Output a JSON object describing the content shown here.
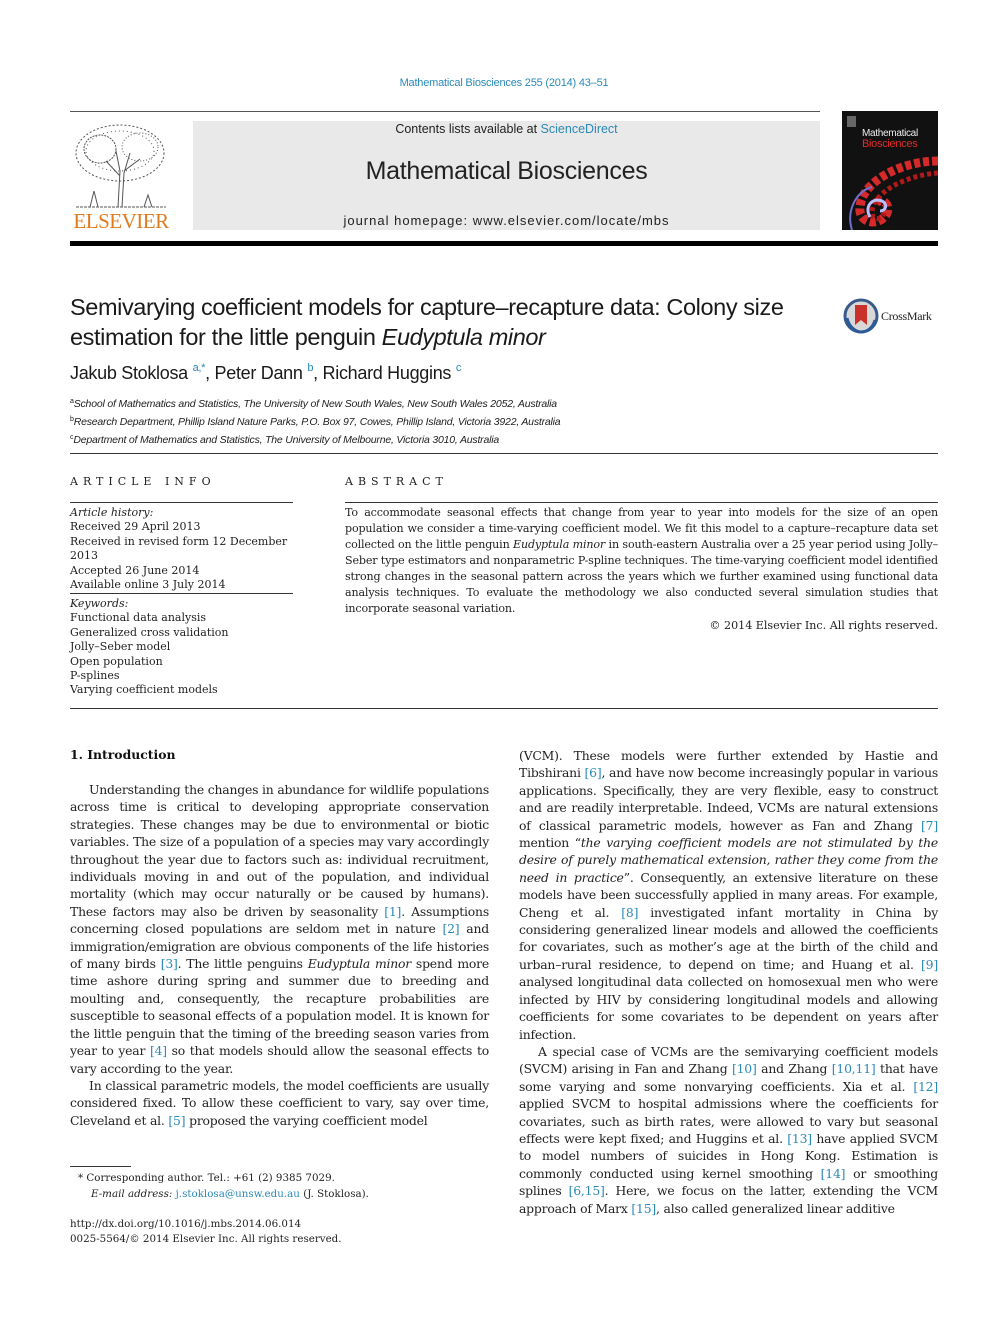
{
  "header": {
    "journal_ref": "Mathematical Biosciences 255 (2014) 43–51",
    "contents_prefix": "Contents lists available at ",
    "contents_link": "ScienceDirect",
    "journal_title": "Mathematical Biosciences",
    "homepage": "journal homepage: www.elsevier.com/locate/mbs",
    "publisher_logo": "ELSEVIER",
    "cover_line1": "Mathematical",
    "cover_line2": "Biosciences",
    "crossmark_label": "CrossMark"
  },
  "article": {
    "title_part1": "Semivarying coefficient models for capture–recapture data: Colony size estimation for the little penguin ",
    "title_italic": "Eudyptula minor",
    "authors": [
      {
        "name": "Jakub Stoklosa",
        "sup": "a,*"
      },
      {
        "name": "Peter Dann",
        "sup": "b"
      },
      {
        "name": "Richard Huggins",
        "sup": "c"
      }
    ],
    "affiliations": [
      {
        "sup": "a",
        "text": "School of Mathematics and Statistics, The University of New South Wales, New South Wales 2052, Australia"
      },
      {
        "sup": "b",
        "text": "Research Department, Phillip Island Nature Parks, P.O. Box 97, Cowes, Phillip Island, Victoria 3922, Australia"
      },
      {
        "sup": "c",
        "text": "Department of Mathematics and Statistics, The University of Melbourne, Victoria 3010, Australia"
      }
    ]
  },
  "article_info": {
    "heading": "ARTICLE INFO",
    "history_label": "Article history:",
    "history": [
      "Received 29 April 2013",
      "Received in revised form 12 December 2013",
      "Accepted 26 June 2014",
      "Available online 3 July 2014"
    ],
    "keywords_label": "Keywords:",
    "keywords": [
      "Functional data analysis",
      "Generalized cross validation",
      "Jolly–Seber model",
      "Open population",
      "P-splines",
      "Varying coefficient models"
    ]
  },
  "abstract": {
    "heading": "ABSTRACT",
    "text_1": "To accommodate seasonal effects that change from year to year into models for the size of an open population we consider a time-varying coefficient model. We fit this model to a capture–recapture data set collected on the little penguin ",
    "text_italic": "Eudyptula minor",
    "text_2": " in south-eastern Australia over a 25 year period using Jolly–Seber type estimators and nonparametric P-spline techniques. The time-varying coefficient model identified strong changes in the seasonal pattern across the years which we further examined using functional data analysis techniques. To evaluate the methodology we also conducted several simulation studies that incorporate seasonal variation.",
    "copyright": "© 2014 Elsevier Inc. All rights reserved."
  },
  "body": {
    "section_heading": "1. Introduction",
    "left": {
      "p1_a": "Understanding the changes in abundance for wildlife populations across time is critical to developing appropriate conservation strategies. These changes may be due to environmental or biotic variables. The size of a population of a species may vary accordingly throughout the year due to factors such as: individual recruitment, individuals moving in and out of the population, and individual mortality (which may occur naturally or be caused by humans). These factors may also be driven by seasonality ",
      "ref1": "[1]",
      "p1_b": ". Assumptions concerning closed populations are seldom met in nature ",
      "ref2": "[2]",
      "p1_c": " and immigration/emigration are obvious components of the life histories of many birds ",
      "ref3": "[3]",
      "p1_d": ". The little penguins ",
      "p1_italic": "Eudyptula minor",
      "p1_e": " spend more time ashore during spring and summer due to breeding and moulting and, consequently, the recapture probabilities are susceptible to seasonal effects of a population model. It is known for the little penguin that the timing of the breeding season varies from year to year ",
      "ref4": "[4]",
      "p1_f": " so that models should allow the seasonal effects to vary according to the year.",
      "p2_a": "In classical parametric models, the model coefficients are usually considered fixed. To allow these coefficient to vary, say over time, Cleveland et al. ",
      "ref5": "[5]",
      "p2_b": " proposed the varying coefficient model"
    },
    "right": {
      "p1_a": "(VCM). These models were further extended by Hastie and Tibshirani ",
      "ref6": "[6]",
      "p1_b": ", and have now become increasingly popular in various applications. Specifically, they are very flexible, easy to construct and are readily interpretable. Indeed, VCMs are natural extensions of classical parametric models, however as Fan and Zhang ",
      "ref7": "[7]",
      "p1_c": " mention “",
      "p1_quote": "the varying coefficient models are not stimulated by the desire of purely mathematical extension, rather they come from the need in practice",
      "p1_d": "”. Consequently, an extensive literature on these models have been successfully applied in many areas. For example, Cheng et al. ",
      "ref8": "[8]",
      "p1_e": " investigated infant mortality in China by considering generalized linear models and allowed the coefficients for covariates, such as mother’s age at the birth of the child and urban–rural residence, to depend on time; and Huang et al. ",
      "ref9": "[9]",
      "p1_f": " analysed longitudinal data collected on homosexual men who were infected by HIV by considering longitudinal models and allowing coefficients for some covariates to be dependent on years after infection.",
      "p2_a": "A special case of VCMs are the semivarying coefficient models (SVCM) arising in Fan and Zhang ",
      "ref10": "[10]",
      "p2_b": " and Zhang ",
      "ref10_11": "[10,11]",
      "p2_c": " that have some varying and some nonvarying coefficients. Xia et al. ",
      "ref12": "[12]",
      "p2_d": " applied SVCM to hospital admissions where the coefficients for covariates, such as birth rates, were allowed to vary but seasonal effects were kept fixed; and Huggins et al. ",
      "ref13": "[13]",
      "p2_e": " have applied SVCM to model numbers of suicides in Hong Kong. Estimation is commonly conducted using kernel smoothing ",
      "ref14": "[14]",
      "p2_f": " or smoothing splines ",
      "ref6_15": "[6,15]",
      "p2_g": ". Here, we focus on the latter, extending the VCM approach of Marx ",
      "ref15": "[15]",
      "p2_h": ", also called generalized linear additive"
    }
  },
  "footer": {
    "corresponding": "* Corresponding author. Tel.: +61 (2) 9385 7029.",
    "email_label": "E-mail address: ",
    "email": "j.stoklosa@unsw.edu.au",
    "email_suffix": " (J. Stoklosa).",
    "doi": "http://dx.doi.org/10.1016/j.mbs.2014.06.014",
    "issn": "0025-5564/© 2014 Elsevier Inc. All rights reserved."
  },
  "colors": {
    "link": "#2a8ab8",
    "elsevier_orange": "#e07b1f",
    "masthead_bg": "#e9e9e9"
  }
}
